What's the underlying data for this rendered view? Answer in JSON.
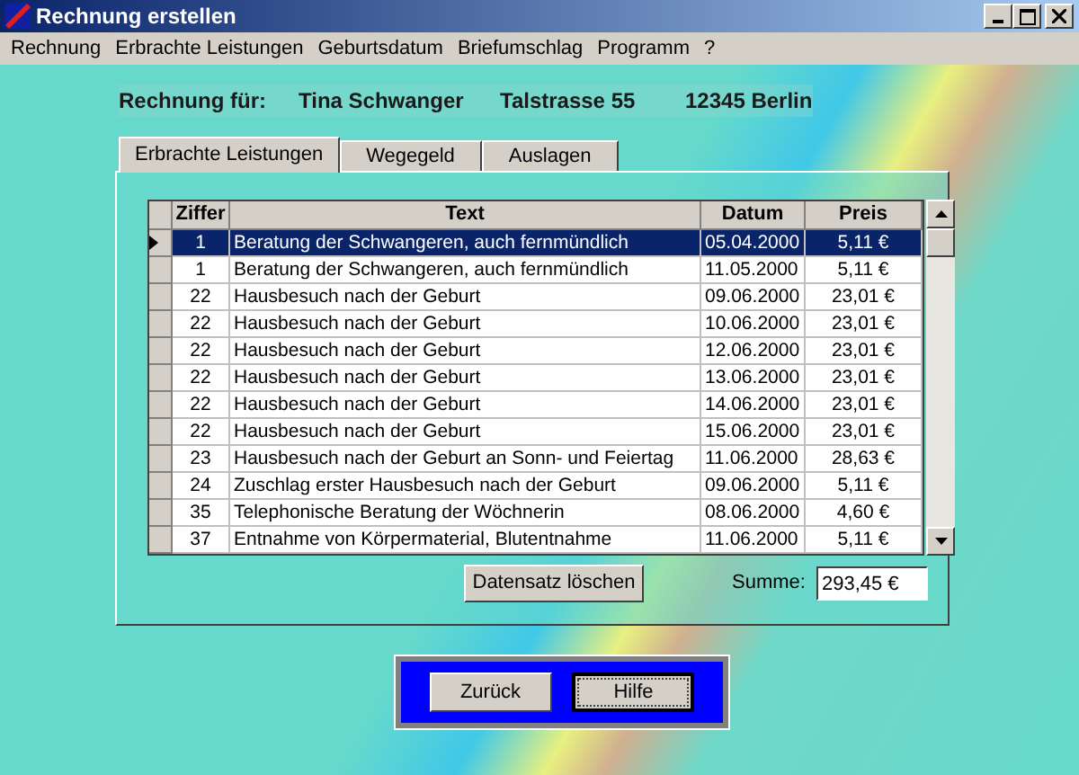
{
  "window": {
    "title": "Rechnung erstellen"
  },
  "menu": [
    "Rechnung",
    "Erbrachte Leistungen",
    "Geburtsdatum",
    "Briefumschlag",
    "Programm",
    "?"
  ],
  "header": {
    "label": "Rechnung für:",
    "name": "Tina Schwanger",
    "street": "Talstrasse 55",
    "city": "12345 Berlin"
  },
  "tabs": [
    {
      "label": "Erbrachte Leistungen",
      "selected": true
    },
    {
      "label": "Wegegeld",
      "selected": false
    },
    {
      "label": "Auslagen",
      "selected": false
    }
  ],
  "table": {
    "columns": [
      "Ziffer",
      "Text",
      "Datum",
      "Preis"
    ],
    "rows": [
      {
        "ziffer": "1",
        "text": "Beratung der Schwangeren, auch fernmündlich",
        "datum": "05.04.2000",
        "preis": "5,11 €",
        "selected": true
      },
      {
        "ziffer": "1",
        "text": "Beratung der Schwangeren, auch fernmündlich",
        "datum": "11.05.2000",
        "preis": "5,11 €",
        "selected": false
      },
      {
        "ziffer": "22",
        "text": "Hausbesuch nach der Geburt",
        "datum": "09.06.2000",
        "preis": "23,01 €",
        "selected": false
      },
      {
        "ziffer": "22",
        "text": "Hausbesuch nach der Geburt",
        "datum": "10.06.2000",
        "preis": "23,01 €",
        "selected": false
      },
      {
        "ziffer": "22",
        "text": "Hausbesuch nach der Geburt",
        "datum": "12.06.2000",
        "preis": "23,01 €",
        "selected": false
      },
      {
        "ziffer": "22",
        "text": "Hausbesuch nach der Geburt",
        "datum": "13.06.2000",
        "preis": "23,01 €",
        "selected": false
      },
      {
        "ziffer": "22",
        "text": "Hausbesuch nach der Geburt",
        "datum": "14.06.2000",
        "preis": "23,01 €",
        "selected": false
      },
      {
        "ziffer": "22",
        "text": "Hausbesuch nach der Geburt",
        "datum": "15.06.2000",
        "preis": "23,01 €",
        "selected": false
      },
      {
        "ziffer": "23",
        "text": "Hausbesuch nach der Geburt an Sonn- und Feiertag",
        "datum": "11.06.2000",
        "preis": "28,63 €",
        "selected": false
      },
      {
        "ziffer": "24",
        "text": "Zuschlag erster Hausbesuch nach der Geburt",
        "datum": "09.06.2000",
        "preis": "5,11 €",
        "selected": false
      },
      {
        "ziffer": "35",
        "text": "Telephonische Beratung der Wöchnerin",
        "datum": "08.06.2000",
        "preis": "4,60 €",
        "selected": false
      },
      {
        "ziffer": "37",
        "text": "Entnahme von Körpermaterial, Blutentnahme",
        "datum": "11.06.2000",
        "preis": "5,11 €",
        "selected": false
      }
    ]
  },
  "delete_button": "Datensatz löschen",
  "sum": {
    "label": "Summe:",
    "value": "293,45 €"
  },
  "buttons": [
    {
      "label": "Zurück",
      "focused": false
    },
    {
      "label": "Hilfe",
      "focused": true
    }
  ]
}
